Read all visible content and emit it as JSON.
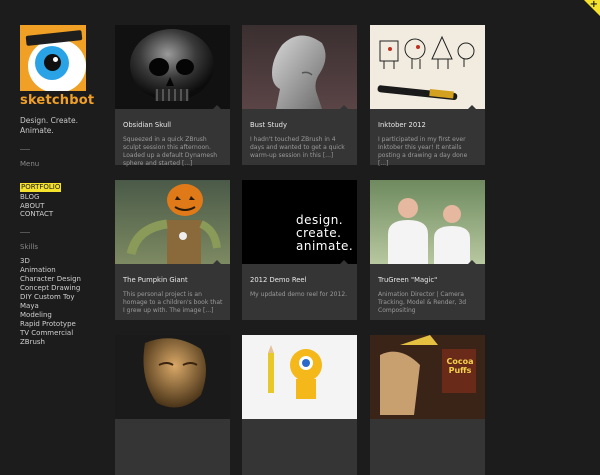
{
  "brand": {
    "name": "sketchbot",
    "tagline": "Design. Create. Animate."
  },
  "menu": {
    "title": "Menu",
    "items": [
      "PORTFOLIO",
      "BLOG",
      "ABOUT",
      "CONTACT"
    ]
  },
  "skills": {
    "title": "Skills",
    "items": [
      "3D",
      "Animation",
      "Character Design",
      "Concept Drawing",
      "DIY Custom Toy",
      "Maya",
      "Modeling",
      "Rapid Prototype",
      "TV Commercial",
      "ZBrush"
    ]
  },
  "cards": [
    {
      "title": "Obsidian Skull",
      "desc": "Squeezed in a quick ZBrush sculpt session this afternoon. Loaded up a default Dynamesh sphere and started [...]"
    },
    {
      "title": "Bust Study",
      "desc": "I hadn't touched ZBrush in 4 days and wanted to get a quick warm-up session in this [...]"
    },
    {
      "title": "Inktober 2012",
      "desc": "I participated in my first ever Inktober this year! It entails posting a drawing a day done [...]"
    },
    {
      "title": "The Pumpkin Giant",
      "desc": "This personal project is an homage to a children's book that I grew up with. The image [...]"
    },
    {
      "title": "2012 Demo Reel",
      "desc": "My updated demo reel for 2012.",
      "thumb_text": [
        "design.",
        "create.",
        "animate."
      ]
    },
    {
      "title": "TruGreen \"Magic\"",
      "desc": "Animation Director | Camera Tracking, Model & Render, 3d Compositing"
    },
    {
      "title": "",
      "desc": ""
    },
    {
      "title": "",
      "desc": ""
    },
    {
      "title": "",
      "desc": "",
      "thumb_text": [
        "Cocoa",
        "Puffs"
      ]
    }
  ],
  "colors": {
    "accent": "#f0a024",
    "highlight": "#f5e22c",
    "background": "#1c1c1c",
    "card": "#353535"
  }
}
